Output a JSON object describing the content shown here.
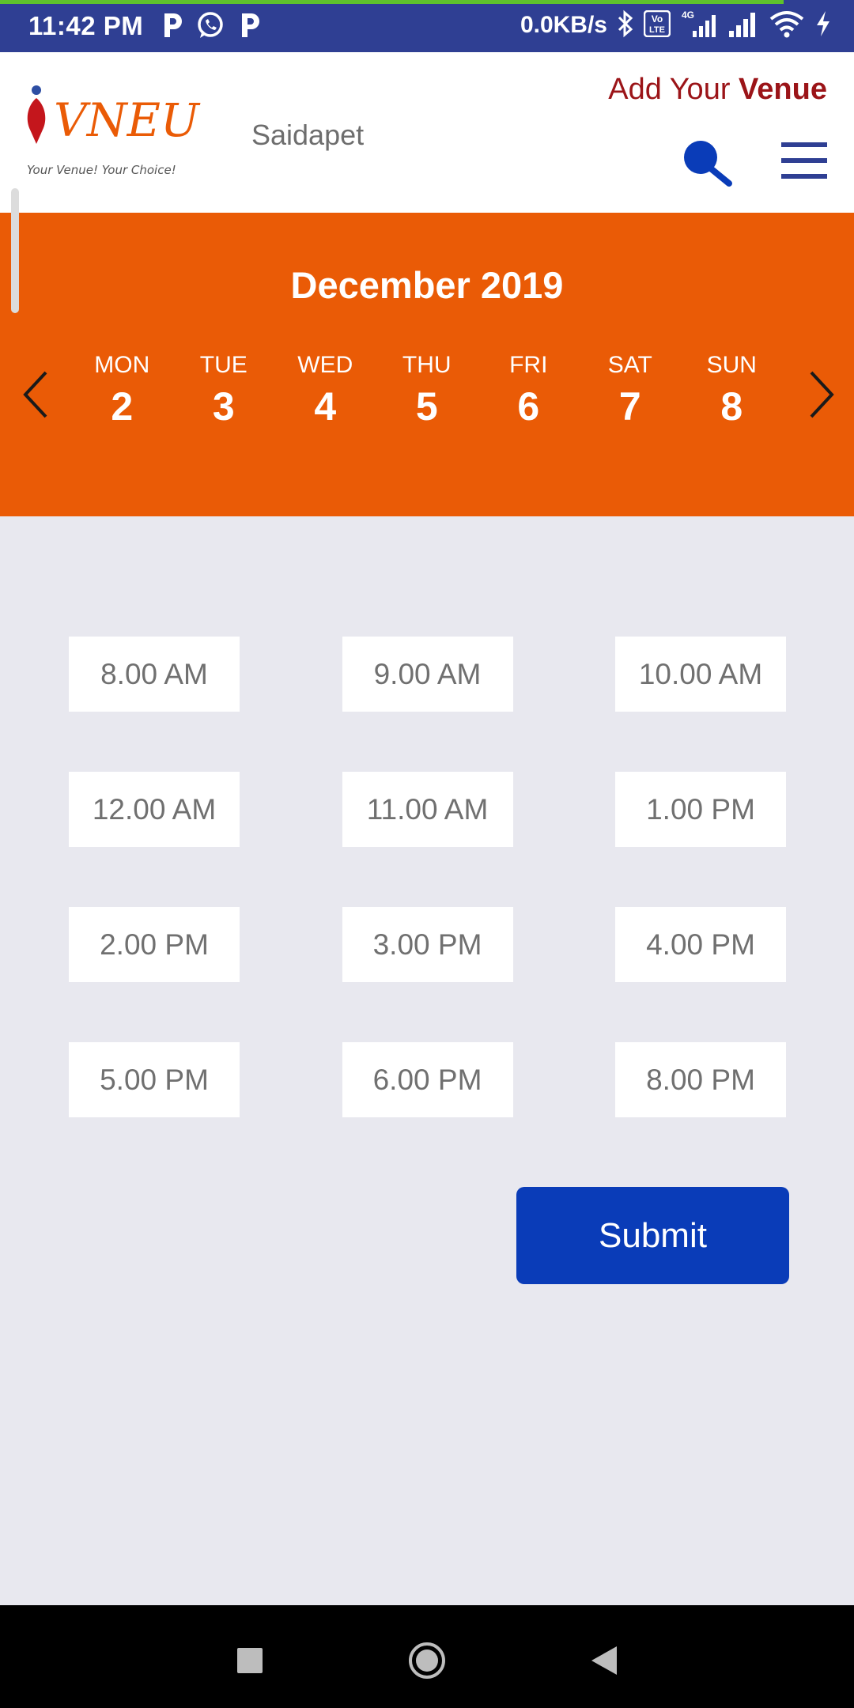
{
  "status_bar": {
    "time": "11:42 PM",
    "net_speed": "0.0KB/s",
    "notification_icons": [
      "p-app-icon",
      "whatsapp-icon",
      "p-app-icon"
    ],
    "system_icons": [
      "bluetooth-icon",
      "volte-icon",
      "4g-signal-icon",
      "signal-icon",
      "wifi-icon",
      "charging-icon"
    ],
    "network_type": "4G",
    "volte_label_top": "Vo",
    "volte_label_bottom": "LTE",
    "colors": {
      "background": "#2f3f93",
      "progress": "#5ec22b"
    }
  },
  "header": {
    "logo": {
      "text": "VNEU",
      "tagline": "Your Venue! Your Choice!"
    },
    "location": "Saidapet",
    "add_venue_prefix": "Add Your ",
    "add_venue_bold": "Venue",
    "colors": {
      "add_venue": "#9b1418",
      "icons": "#0a3cb8"
    }
  },
  "calendar": {
    "month_label": "December 2019",
    "days": [
      {
        "name": "MON",
        "num": "2"
      },
      {
        "name": "TUE",
        "num": "3"
      },
      {
        "name": "WED",
        "num": "4"
      },
      {
        "name": "THU",
        "num": "5"
      },
      {
        "name": "FRI",
        "num": "6"
      },
      {
        "name": "SAT",
        "num": "7"
      },
      {
        "name": "SUN",
        "num": "8"
      }
    ],
    "color": "#ea5b06"
  },
  "time_slots": [
    "8.00 AM",
    "9.00 AM",
    "10.00 AM",
    "12.00 AM",
    "11.00 AM",
    "1.00 PM",
    "2.00 PM",
    "3.00 PM",
    "4.00 PM",
    "5.00 PM",
    "6.00 PM",
    "8.00 PM"
  ],
  "submit_label": "Submit",
  "nav_bar": {
    "buttons": [
      "recents-button",
      "home-button",
      "back-button"
    ]
  }
}
